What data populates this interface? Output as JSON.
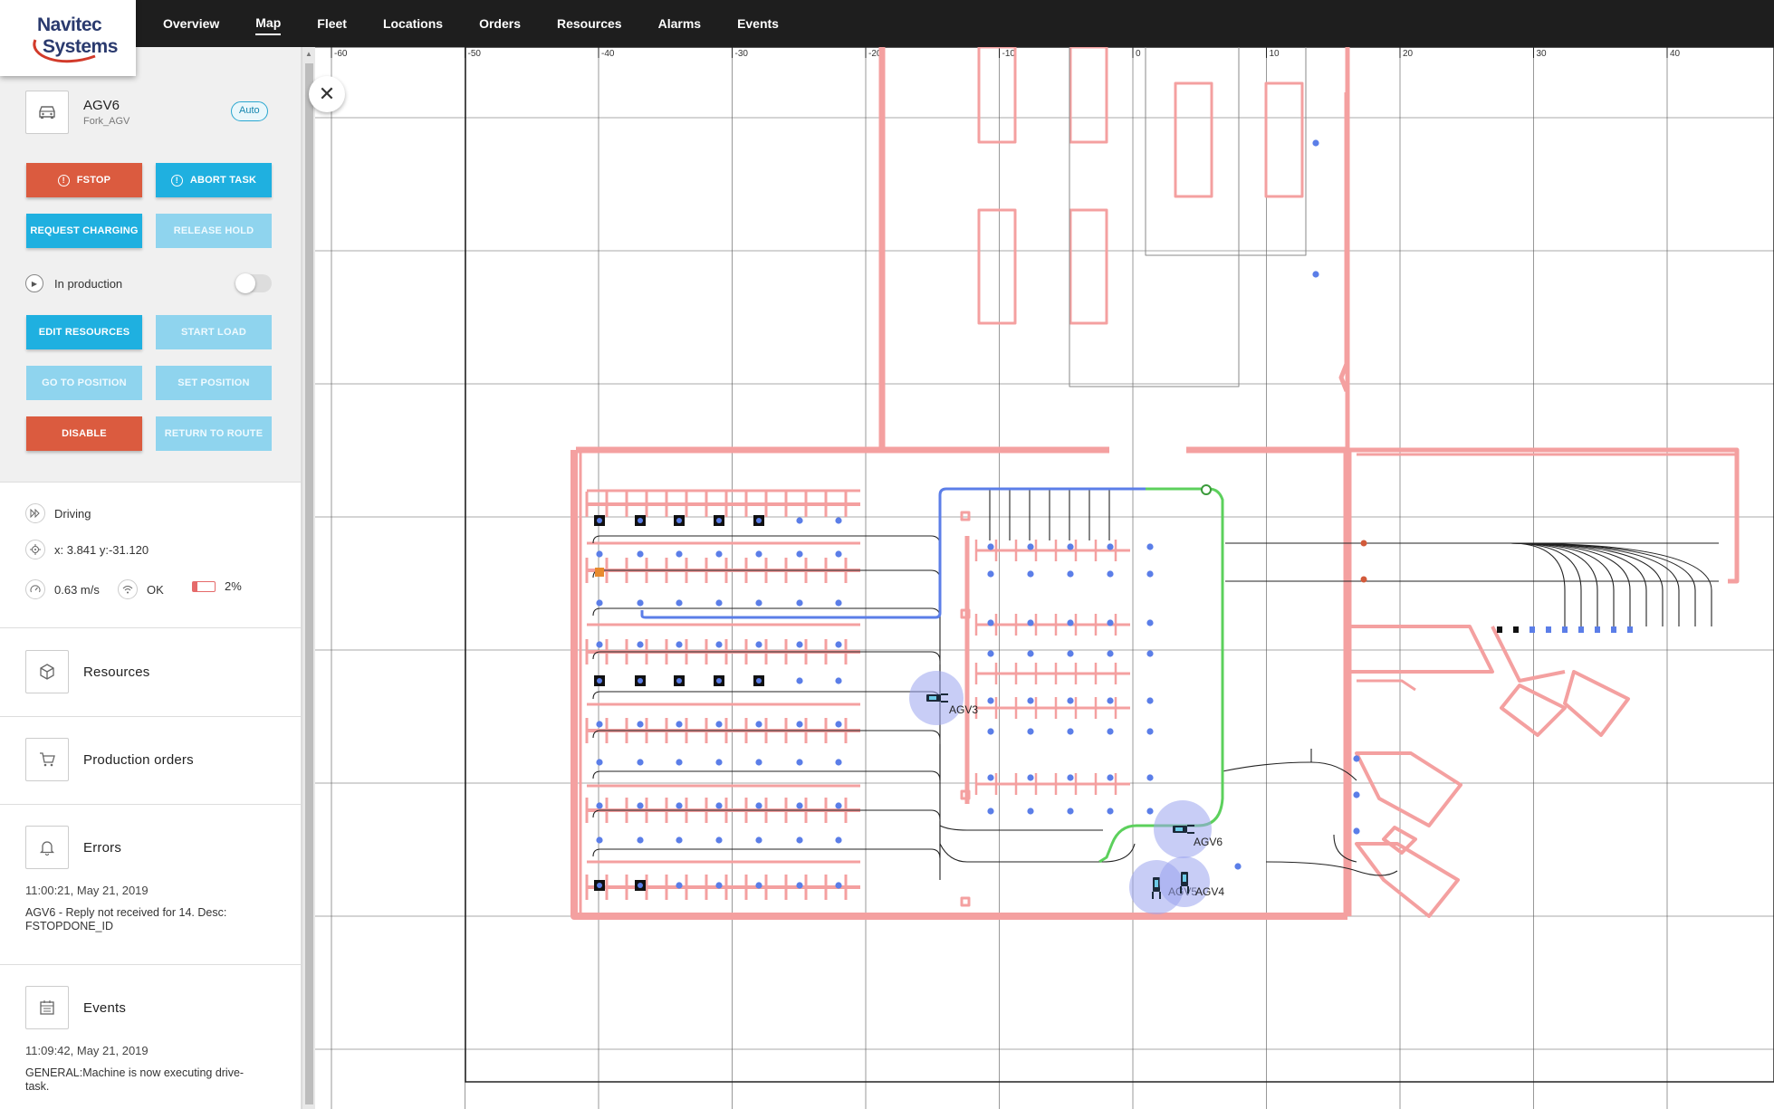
{
  "brand": {
    "line1": "Navitec",
    "line2": "Systems"
  },
  "nav": {
    "items": [
      "Overview",
      "Map",
      "Fleet",
      "Locations",
      "Orders",
      "Resources",
      "Alarms",
      "Events"
    ],
    "active": "Map"
  },
  "vehicle": {
    "name": "AGV6",
    "type": "Fork_AGV",
    "mode": "Auto"
  },
  "buttons": {
    "fstop": "FSTOP",
    "abort_task": "ABORT TASK",
    "request_charging": "REQUEST CHARGING",
    "release_hold": "RELEASE HOLD",
    "edit_resources": "EDIT RESOURCES",
    "start_load": "START LOAD",
    "go_to_position": "GO TO POSITION",
    "set_position": "SET POSITION",
    "disable": "DISABLE",
    "return_to_route": "RETURN TO ROUTE"
  },
  "production": {
    "label": "In production",
    "enabled": false
  },
  "status": {
    "state": "Driving",
    "position": "x: 3.841 y:-31.120",
    "speed": "0.63 m/s",
    "connection": "OK",
    "battery": "2%",
    "battery_level": 0.02
  },
  "sections": {
    "resources": "Resources",
    "production_orders": "Production orders",
    "errors": "Errors",
    "events": "Events"
  },
  "errors": {
    "time": "11:00:21, May 21, 2019",
    "text": "AGV6 - Reply not received for 14. Desc: FSTOPDONE_ID"
  },
  "events": {
    "time": "11:09:42, May 21, 2019",
    "text": "GENERAL:Machine is now executing drive-task."
  },
  "map": {
    "x_ticks": [
      "-60",
      "-50",
      "-40",
      "-30",
      "-20",
      "-10",
      "0",
      "10",
      "20",
      "30",
      "40"
    ],
    "vehicles": [
      {
        "label": "AGV3"
      },
      {
        "label": "AGV6"
      },
      {
        "label": "AGV5"
      },
      {
        "label": "AGV4"
      }
    ],
    "colors": {
      "walls": "#f4a0a0",
      "route_active": "#5b7ee8",
      "route_planned": "#5cd05c",
      "station": "#5b7ee8",
      "vehicle_halo": "#9aa4ef"
    }
  }
}
